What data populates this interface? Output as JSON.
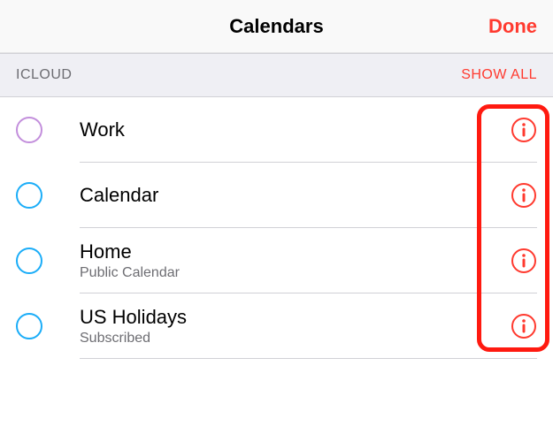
{
  "navbar": {
    "title": "Calendars",
    "done": "Done"
  },
  "section": {
    "title": "ICLOUD",
    "show_all": "SHOW ALL"
  },
  "colors": {
    "purple": "#c38fdc",
    "blue": "#1badf8",
    "red": "#ff3a2f"
  },
  "calendars": [
    {
      "name": "Work",
      "subtitle": "",
      "color_key": "purple"
    },
    {
      "name": "Calendar",
      "subtitle": "",
      "color_key": "blue"
    },
    {
      "name": "Home",
      "subtitle": "Public Calendar",
      "color_key": "blue"
    },
    {
      "name": "US Holidays",
      "subtitle": "Subscribed",
      "color_key": "blue"
    }
  ]
}
